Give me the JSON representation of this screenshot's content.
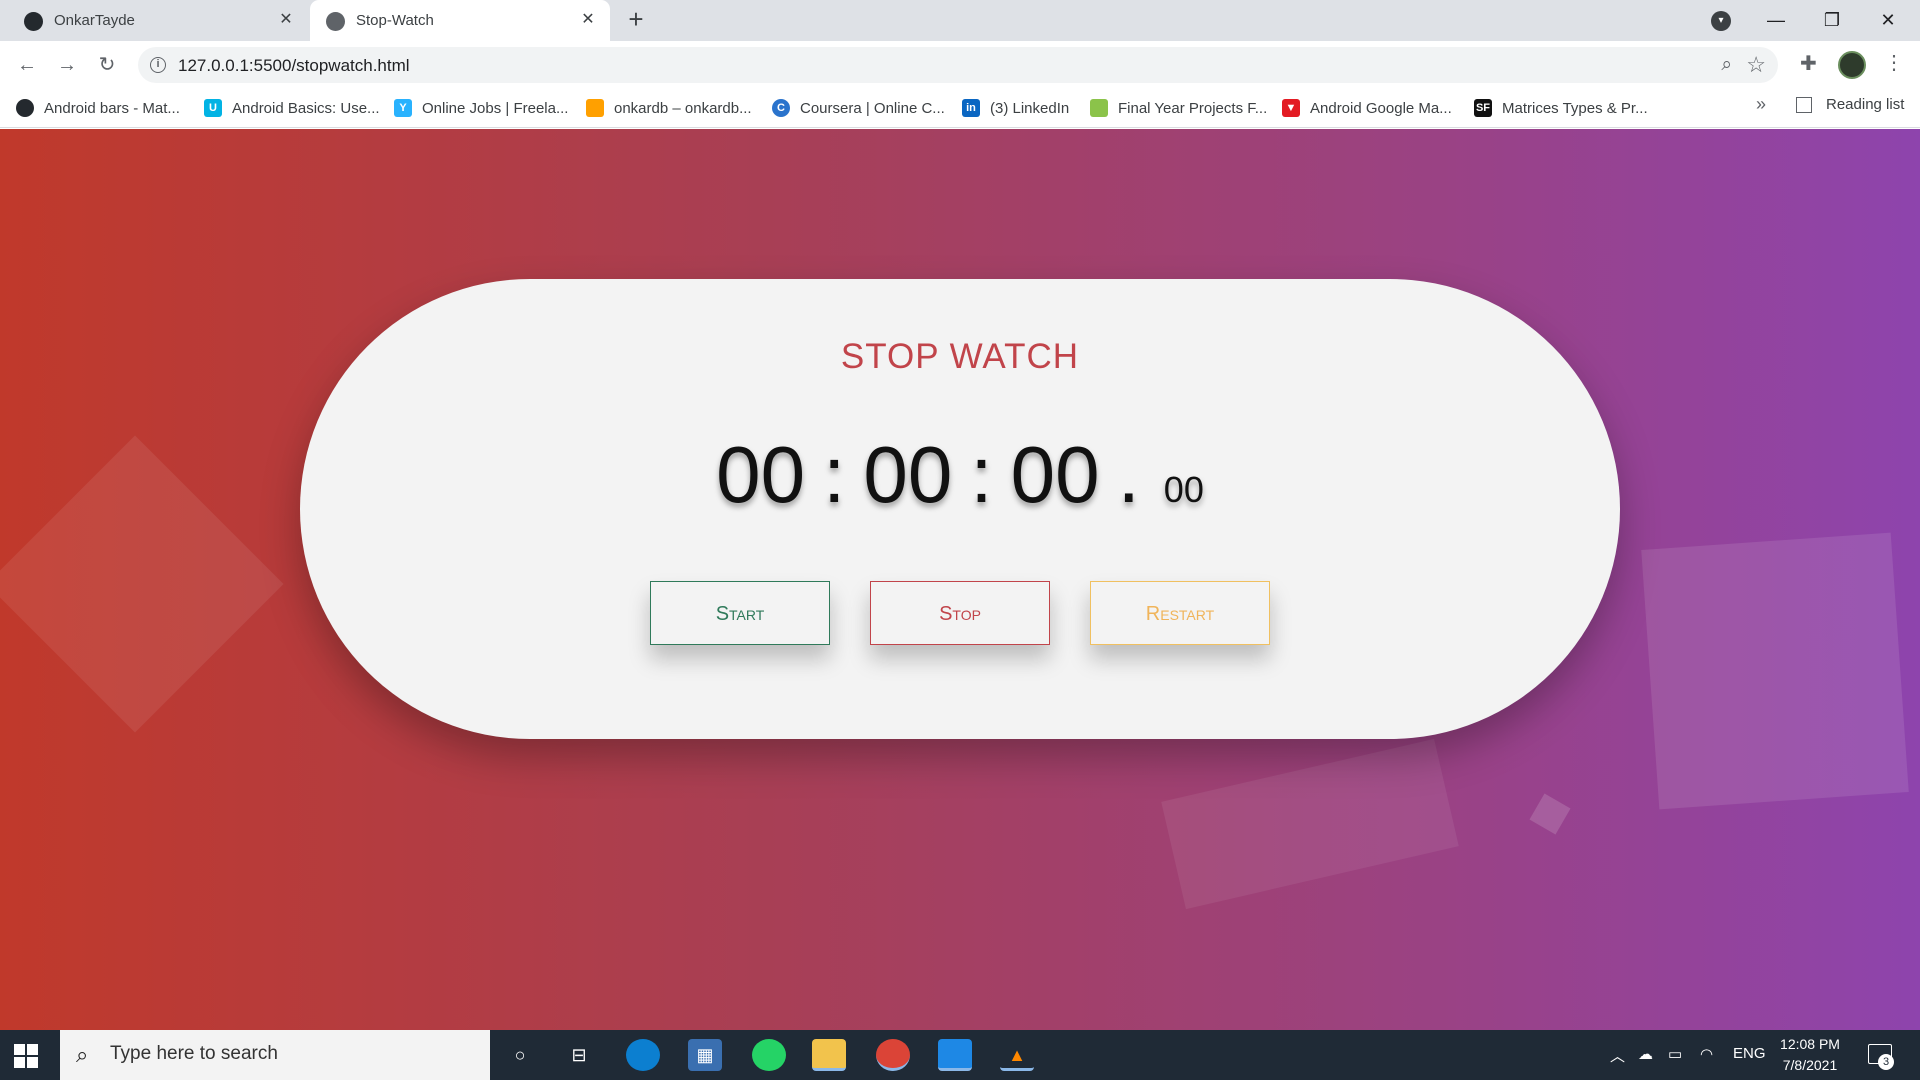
{
  "browser": {
    "tabs": [
      {
        "title": "OnkarTayde",
        "icon": "github-icon"
      },
      {
        "title": "Stop-Watch",
        "icon": "globe-icon",
        "active": true
      }
    ],
    "url": "127.0.0.1:5500/stopwatch.html",
    "bookmarks": [
      {
        "label": "Android bars - Mat...",
        "icon": "github-icon",
        "color": "#24292e"
      },
      {
        "label": "Android Basics: Use...",
        "icon": "udacity-icon",
        "color": "#02b3e4"
      },
      {
        "label": "Online Jobs | Freela...",
        "icon": "freelancer-icon",
        "color": "#29b2fe"
      },
      {
        "label": "onkardb – onkardb...",
        "icon": "firebase-icon",
        "color": "#ffa000"
      },
      {
        "label": "Coursera | Online C...",
        "icon": "coursera-icon",
        "color": "#2a73cc"
      },
      {
        "label": "(3) LinkedIn",
        "icon": "linkedin-icon",
        "color": "#0a66c2"
      },
      {
        "label": "Final Year Projects F...",
        "icon": "leaf-icon",
        "color": "#8bc34a"
      },
      {
        "label": "Android Google Ma...",
        "icon": "triangle-icon",
        "color": "#e31b23"
      },
      {
        "label": "Matrices Types & Pr...",
        "icon": "sf-icon",
        "color": "#111111"
      }
    ],
    "more_bookmarks": "»",
    "reading_list": "Reading list"
  },
  "stopwatch": {
    "title": "STOP WATCH",
    "hours": "00",
    "minutes": "00",
    "seconds": "00",
    "centiseconds": "00",
    "sep1": ":",
    "sep2": ":",
    "sep3": ".",
    "buttons": {
      "start": "Start",
      "stop": "Stop",
      "restart": "Restart"
    }
  },
  "taskbar": {
    "search_placeholder": "Type here to search",
    "language": "ENG",
    "time": "12:08 PM",
    "date": "7/8/2021",
    "notifications": "3"
  }
}
